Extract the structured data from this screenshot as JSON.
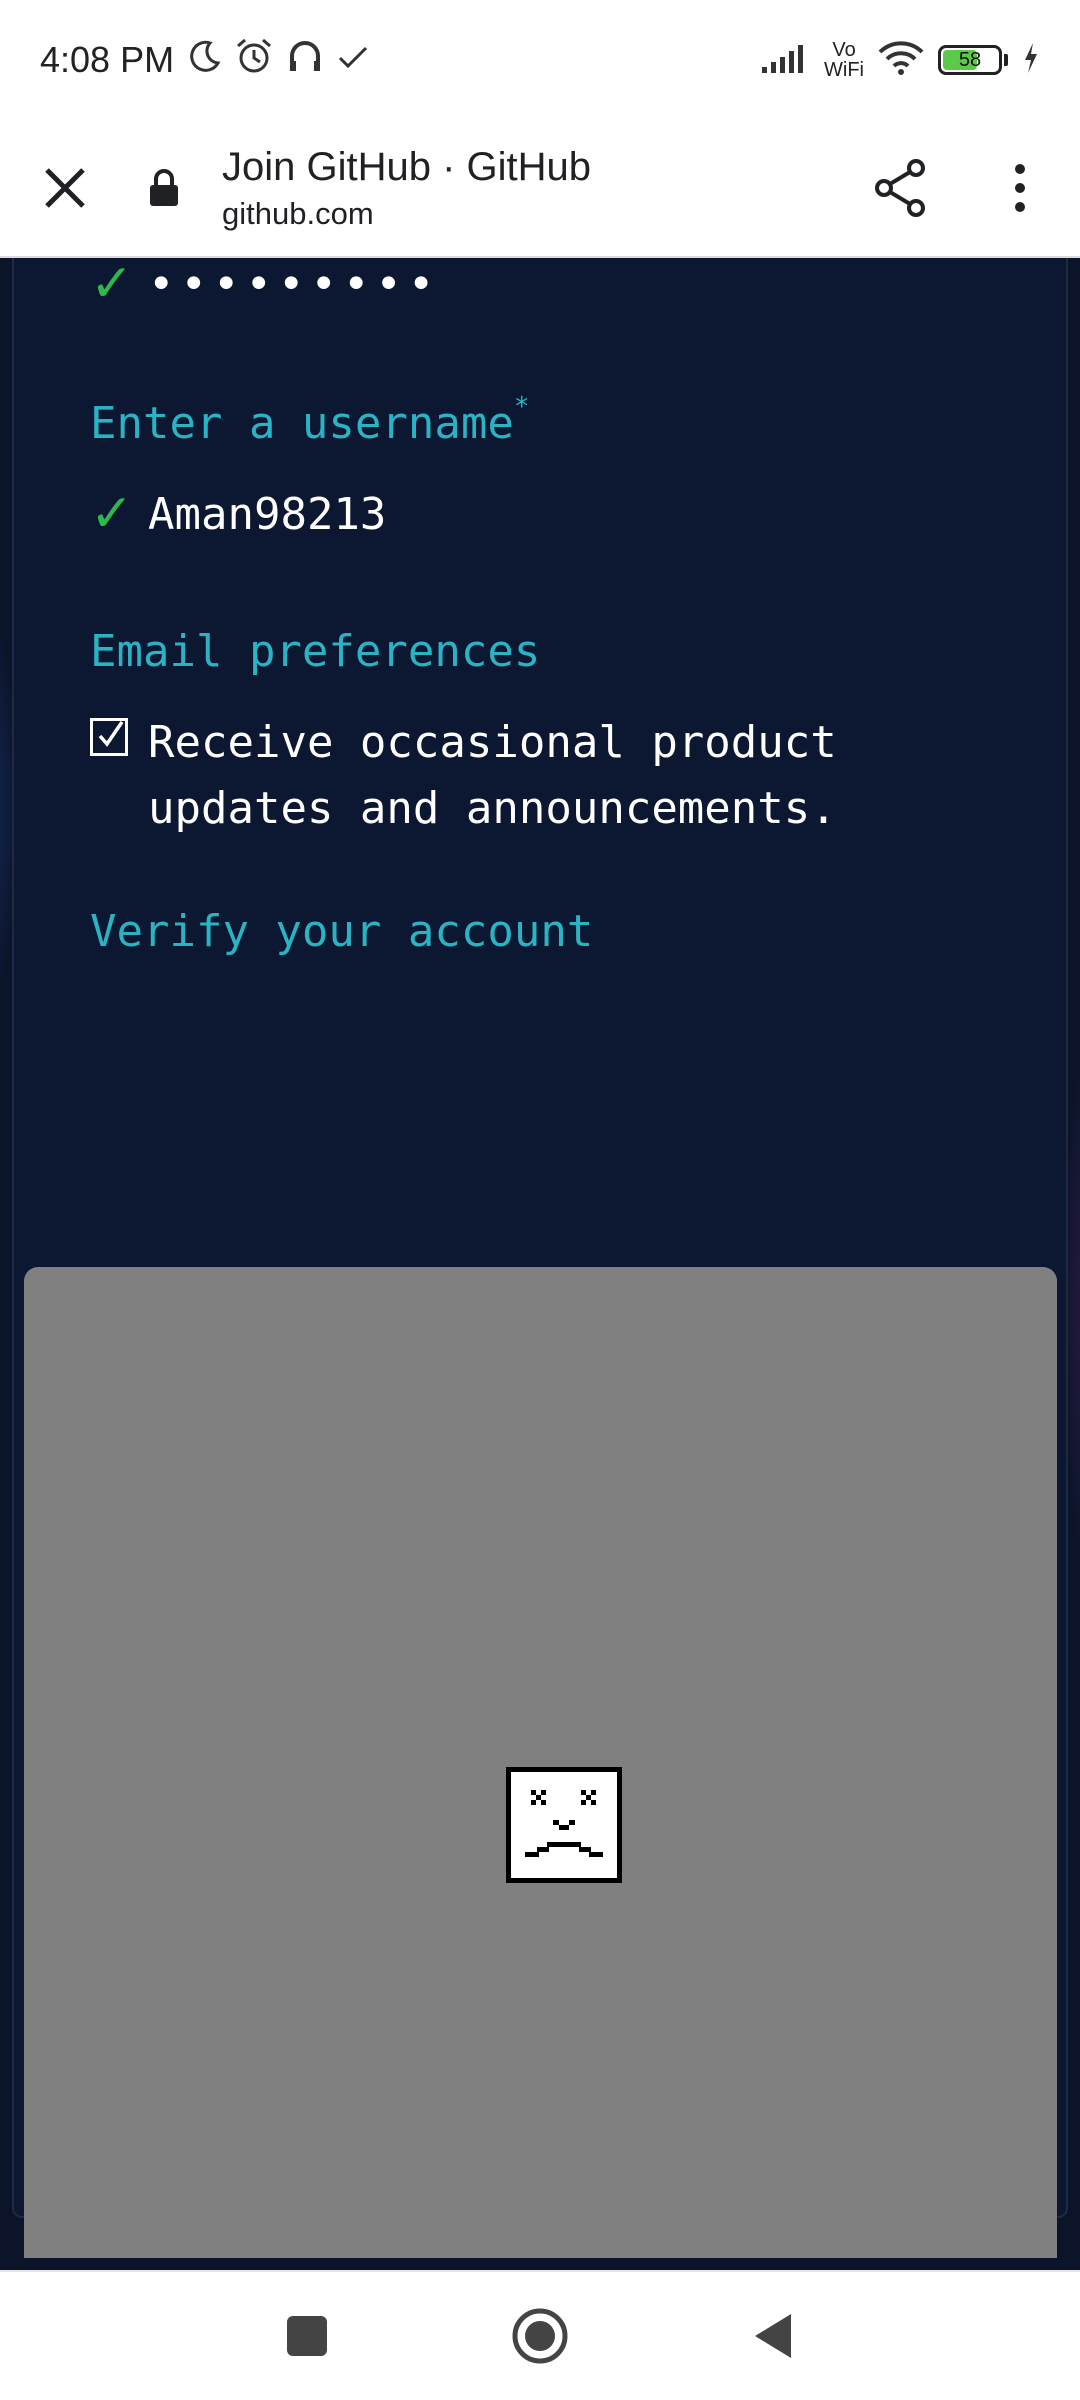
{
  "status_bar": {
    "time": "4:08 PM",
    "icons_left": [
      "moon-icon",
      "alarm-icon",
      "headphones-icon",
      "check-icon"
    ],
    "icons_right": [
      "signal-icon",
      "vowifi-icon",
      "wifi-icon",
      "battery-icon",
      "charging-icon"
    ],
    "vowifi_line1": "Vo",
    "vowifi_line2": "WiFi",
    "battery_level": "58"
  },
  "browser": {
    "page_title": "Join GitHub · GitHub",
    "url": "github.com"
  },
  "form": {
    "password_value": "•••••••••",
    "username_label": "Enter a username",
    "username_required_mark": "*",
    "username_value": "Aman98213",
    "email_pref_label": "Email preferences",
    "email_pref_text": "Receive occasional product updates and announcements.",
    "email_pref_checked": true,
    "verify_label": "Verify your account"
  },
  "colors": {
    "page_bg": "#0b1429",
    "label": "#2ab3c5",
    "check": "#2db84b",
    "captcha_bg": "#808080"
  }
}
